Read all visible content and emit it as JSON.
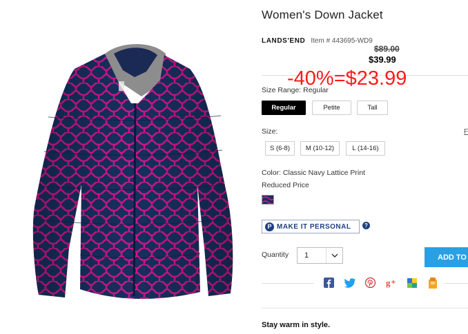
{
  "product": {
    "title": "Women's Down Jacket",
    "brand": "LANDS'END",
    "item_number": "Item # 443695-WD9",
    "old_price": "$89.00",
    "new_price": "$39.99",
    "discount_overlay": "-40%=$23.99",
    "tagline": "Stay warm in style."
  },
  "size_range": {
    "label": "Size Range: Regular",
    "options": [
      "Regular",
      "Petite",
      "Tall"
    ],
    "selected": "Regular"
  },
  "size": {
    "label": "Size:",
    "right_mark": "F",
    "options": [
      "S (6-8)",
      "M (10-12)",
      "L (14-16)"
    ]
  },
  "color": {
    "label": "Color: Classic Navy Lattice Print",
    "note": "Reduced Price",
    "swatch_colors": [
      "#1d2f5e",
      "#d1168c"
    ]
  },
  "personalize": {
    "icon_letter": "P",
    "label": "MAKE IT PERSONAL",
    "help_glyph": "?"
  },
  "quantity": {
    "label": "Quantity",
    "value": "1"
  },
  "cart": {
    "add_label": "ADD TO"
  },
  "share": {
    "icons": [
      "facebook-icon",
      "twitter-icon",
      "pinterest-icon",
      "google-plus-icon",
      "delicious-icon",
      "save-icon"
    ]
  },
  "colors": {
    "accent_blue": "#2b9fe3",
    "discount_red": "#ff1a1a",
    "brand_navy": "#1f3f7f"
  }
}
